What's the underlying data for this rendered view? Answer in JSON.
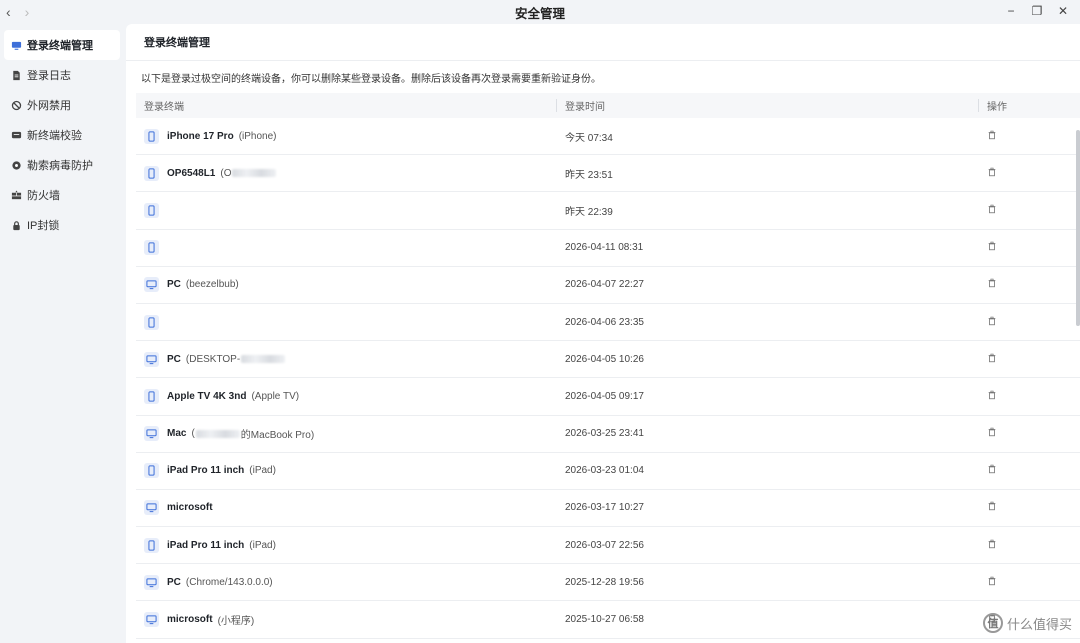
{
  "window": {
    "title": "安全管理",
    "back_glyph": "‹",
    "forward_glyph": "›",
    "minimize_glyph": "−",
    "restore_glyph": "❐",
    "close_glyph": "✕"
  },
  "sidebar": {
    "items": [
      {
        "label": "登录终端管理",
        "icon": "monitor-icon",
        "active": true
      },
      {
        "label": "登录日志",
        "icon": "document-icon",
        "active": false
      },
      {
        "label": "外网禁用",
        "icon": "ban-icon",
        "active": false
      },
      {
        "label": "新终端校验",
        "icon": "message-icon",
        "active": false
      },
      {
        "label": "勒索病毒防护",
        "icon": "shield-gear-icon",
        "active": false
      },
      {
        "label": "防火墙",
        "icon": "firewall-icon",
        "active": false
      },
      {
        "label": "IP封锁",
        "icon": "lock-icon",
        "active": false
      }
    ]
  },
  "main": {
    "heading": "登录终端管理",
    "description": "以下是登录过极空间的终端设备，你可以删除某些登录设备。删除后该设备再次登录需要重新验证身份。",
    "columns": {
      "device": "登录终端",
      "time": "登录时间",
      "action": "操作"
    },
    "rows": [
      {
        "type": "phone",
        "name": "iPhone 17 Pro",
        "sub": "(iPhone)",
        "time": "今天 07:34"
      },
      {
        "type": "phone",
        "name": "OP6548L1",
        "sub": "(O",
        "blurred": true,
        "time": "昨天 23:51"
      },
      {
        "type": "phone",
        "name": "",
        "sub": "",
        "time": "昨天 22:39"
      },
      {
        "type": "phone",
        "name": "",
        "sub": "",
        "time": "2026-04-11 08:31"
      },
      {
        "type": "pc",
        "name": "PC",
        "sub": "(beezelbub)",
        "time": "2026-04-07 22:27"
      },
      {
        "type": "phone",
        "name": "",
        "sub": "",
        "time": "2026-04-06 23:35"
      },
      {
        "type": "pc",
        "name": "PC",
        "sub": "(DESKTOP-",
        "blurred": true,
        "time": "2026-04-05 10:26"
      },
      {
        "type": "phone",
        "name": "Apple TV 4K 3nd",
        "sub": "(Apple TV)",
        "time": "2026-04-05 09:17"
      },
      {
        "type": "pc",
        "name": "Mac",
        "sub": "(",
        "blurred": true,
        "sub_after": "的MacBook Pro)",
        "time": "2026-03-25 23:41"
      },
      {
        "type": "phone",
        "name": "iPad Pro 11 inch",
        "sub": "(iPad)",
        "time": "2026-03-23 01:04"
      },
      {
        "type": "pc",
        "name": "microsoft",
        "sub": "",
        "time": "2026-03-17 10:27"
      },
      {
        "type": "phone",
        "name": "iPad Pro 11 inch",
        "sub": "(iPad)",
        "time": "2026-03-07 22:56"
      },
      {
        "type": "pc",
        "name": "PC",
        "sub": "(Chrome/143.0.0.0)",
        "time": "2025-12-28 19:56"
      },
      {
        "type": "pc",
        "name": "microsoft",
        "sub": "(小程序)",
        "time": "2025-10-27 06:58"
      }
    ]
  },
  "watermark": {
    "logo": "值",
    "text": "什么值得买"
  },
  "colors": {
    "accent": "#3d6fd9",
    "icon_bg": "#e7edfa",
    "sidebar_bg": "#f2f4f7"
  }
}
